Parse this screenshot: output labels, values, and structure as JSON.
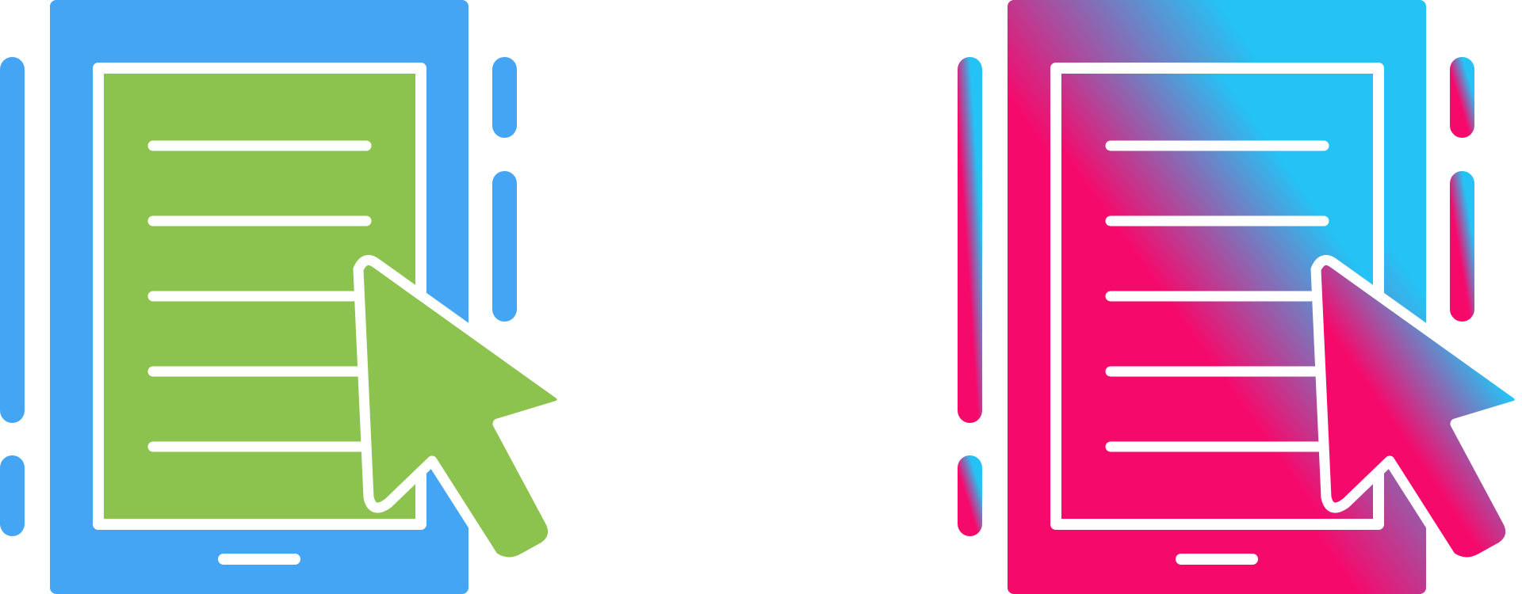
{
  "icons": [
    {
      "name": "tablet-document-click-icon",
      "style": "glyph",
      "colors": {
        "device": "#45A5F5",
        "screen": "#8CC34F",
        "cursor": "#8CC34F",
        "stroke": "#FFFFFF"
      }
    },
    {
      "name": "tablet-document-click-icon",
      "style": "gradient",
      "colors": {
        "gradient_start": "#F50A6C",
        "gradient_end": "#25C2F5",
        "stroke": "#FFFFFF"
      }
    }
  ],
  "background": "#FFFFFF"
}
